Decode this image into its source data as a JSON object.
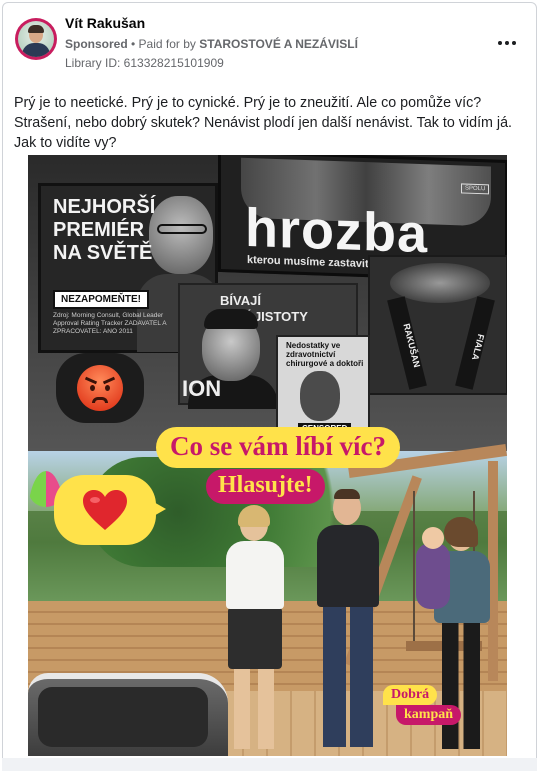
{
  "post": {
    "author_name": "Vít Rakušan",
    "sponsored_label": "Sponsored",
    "separator": " • ",
    "paid_for_by_prefix": "Paid for by ",
    "paid_for_by_name": "STAROSTOVÉ A NEZÁVISLÍ",
    "library_id": "Library ID: 613328215101909",
    "more_icon": "more-horizontal-icon",
    "text": "Prý je to neetické. Prý je to cynické. Prý je to zneužití. Ale co pomůže víc? Strašení, nebo dobrý skutek? Nenávist plodí jen další nenávist. Tak to vidím já. Jak to vidíte vy?"
  },
  "ad_image": {
    "billboard_left": {
      "headline": [
        "NEJHORŠÍ",
        "PREMIÉR",
        "NA SVĚTĚ"
      ],
      "stamp": "NEZAPOMEŇTE!",
      "fine_print": "Zdroj: Morning Consult, Global Leader Approval Rating Tracker ZADAVATEL A ZPRACOVATEL: ANO 2011"
    },
    "billboard_top": {
      "headline": "hrozba",
      "subline": "kterou musíme zastavit",
      "brand": "SPOLU"
    },
    "billboard_mid": {
      "text": [
        "BÍVAJÍ",
        "ÁLNÍ JISTOTY"
      ],
      "fragment": "ION"
    },
    "billboard_small": {
      "text": "Nedostatky ve zdravotnictví chirurgové a doktoři",
      "stamp": "CENSORED"
    },
    "billboard_right": {
      "ribbon_left": "RAKUŠAN",
      "ribbon_right": "FIALA"
    },
    "angry_emoji": "angry-face-icon",
    "heart_emoji": "red-heart-icon",
    "question": "Co se vám líbí víc?",
    "call_to_action": "Hlasujte!",
    "badge_line1": "Dobrá",
    "badge_line2": "kampaň",
    "colors": {
      "brand_magenta": "#c71869",
      "brand_yellow": "#ffe24a",
      "avatar_ring": "#c81d5e"
    }
  }
}
